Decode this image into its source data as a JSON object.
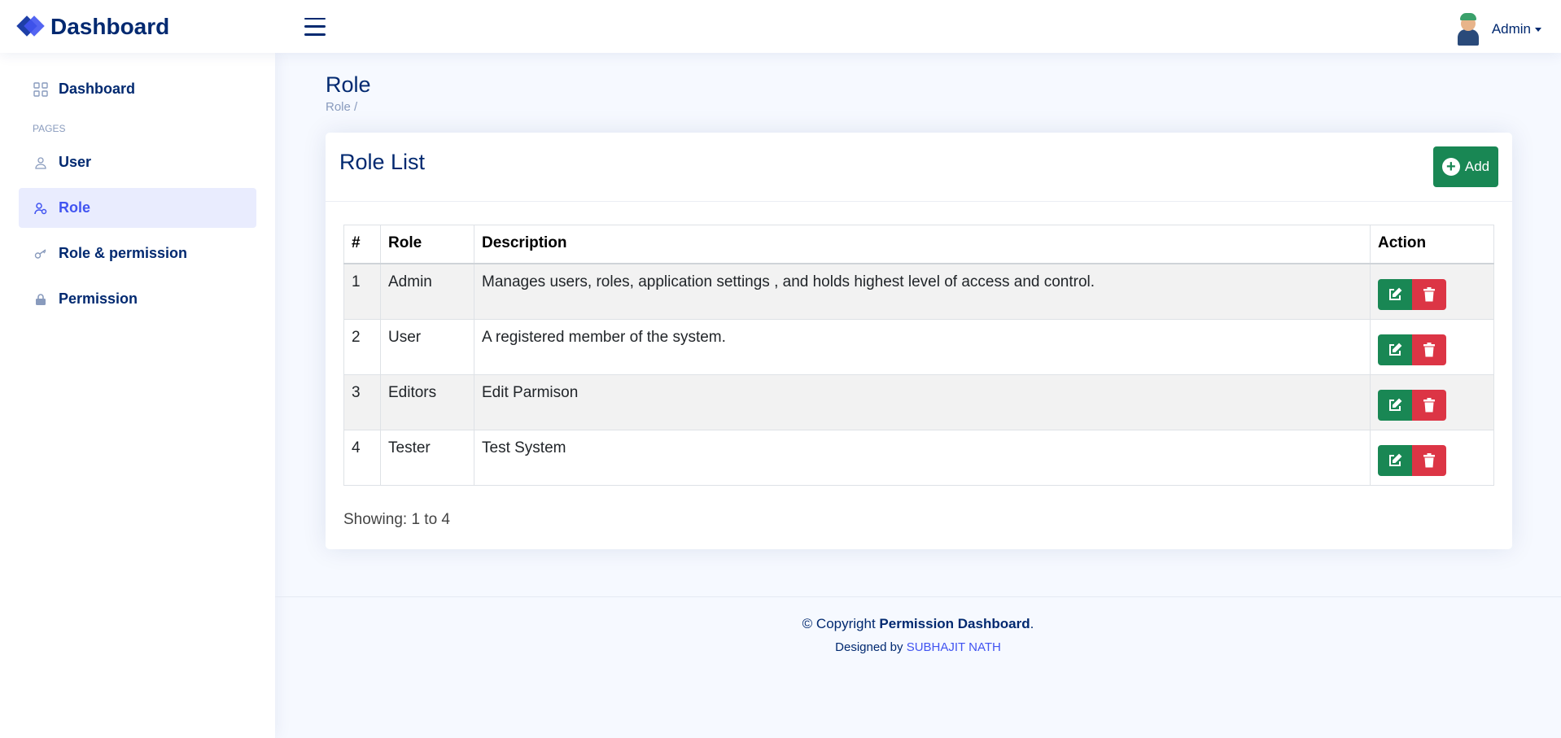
{
  "header": {
    "logo_text": "Dashboard",
    "profile_name": "Admin"
  },
  "sidebar": {
    "dashboard_label": "Dashboard",
    "pages_heading": "PAGES",
    "items": [
      {
        "label": "User",
        "icon": "person-icon"
      },
      {
        "label": "Role",
        "icon": "person-badge-icon",
        "active": true
      },
      {
        "label": "Role & permission",
        "icon": "key-icon"
      },
      {
        "label": "Permission",
        "icon": "lock-icon"
      }
    ]
  },
  "page": {
    "title": "Role",
    "breadcrumb": "Role /"
  },
  "card": {
    "title": "Role List",
    "add_label": "Add",
    "headers": [
      "#",
      "Role",
      "Description",
      "Action"
    ],
    "rows": [
      {
        "num": "1",
        "role": "Admin",
        "description": "Manages users, roles, application settings , and holds highest level of access and control."
      },
      {
        "num": "2",
        "role": "User",
        "description": "A registered member of the system."
      },
      {
        "num": "3",
        "role": "Editors",
        "description": "Edit Parmison"
      },
      {
        "num": "4",
        "role": "Tester",
        "description": "Test System"
      }
    ],
    "showing": "Showing: 1 to 4"
  },
  "footer": {
    "copyright_prefix": "© Copyright ",
    "copyright_bold": "Permission Dashboard",
    "copyright_suffix": ".",
    "designed_prefix": "Designed by ",
    "designed_by": "SUBHAJIT NATH"
  },
  "colors": {
    "primary": "#4154f1",
    "navy": "#012970",
    "success": "#198754",
    "danger": "#dc3545"
  }
}
